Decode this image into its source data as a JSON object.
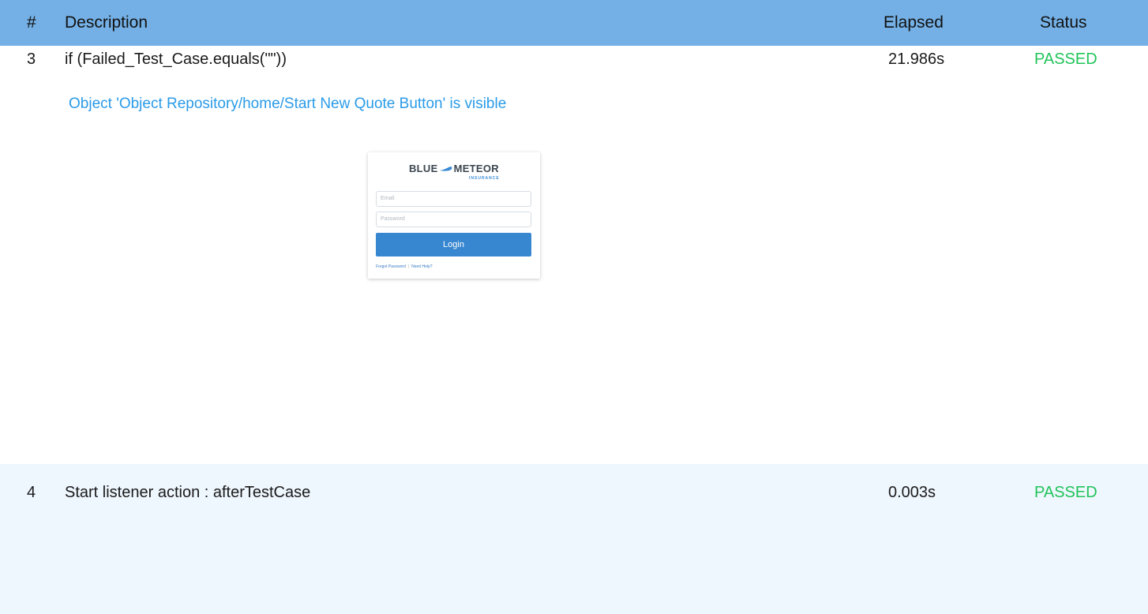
{
  "header": {
    "num": "#",
    "description": "Description",
    "elapsed": "Elapsed",
    "status": "Status"
  },
  "rows": [
    {
      "num": "3",
      "description": "if (Failed_Test_Case.equals(\"\"))",
      "elapsed": "21.986s",
      "status": "PASSED",
      "message": "Object 'Object Repository/home/Start New Quote Button' is visible"
    },
    {
      "num": "4",
      "description": "Start listener action : afterTestCase",
      "elapsed": "0.003s",
      "status": "PASSED"
    }
  ],
  "screenshot": {
    "logo_left": "BLUE",
    "logo_right": "METEOR",
    "logo_sub": "INSURANCE",
    "email_placeholder": "Email",
    "password_placeholder": "Password",
    "login_label": "Login",
    "forgot_link": "Forgot Password",
    "separator": "|",
    "help_link": "Need Help?"
  },
  "colors": {
    "header_bg": "#74b0e5",
    "passed": "#21c45a",
    "message": "#2a9be8",
    "row_alt_bg": "#eef6fe",
    "login_button": "#3786d0"
  }
}
